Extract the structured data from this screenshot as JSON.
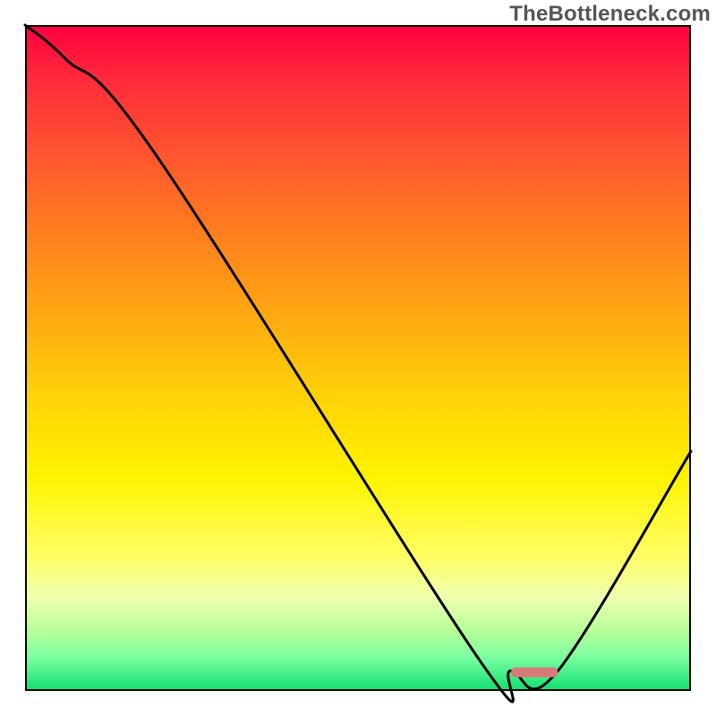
{
  "watermark": "TheBottleneck.com",
  "colors": {
    "curve": "#000000",
    "marker": "#d97a7a",
    "frame": "#000000"
  },
  "chart_data": {
    "type": "line",
    "title": "",
    "xlabel": "",
    "ylabel": "",
    "xlim": [
      0,
      100
    ],
    "ylim": [
      0,
      100
    ],
    "grid": false,
    "legend": false,
    "series": [
      {
        "name": "bottleneck-curve",
        "x": [
          0,
          6,
          20,
          68,
          73,
          80,
          100
        ],
        "values": [
          100,
          95,
          80,
          5,
          3,
          3,
          36
        ]
      }
    ],
    "annotations": [
      {
        "name": "flat-marker",
        "type": "rect",
        "x_center": 76.5,
        "y_center": 2.8,
        "w": 7,
        "h": 1.5
      }
    ]
  }
}
